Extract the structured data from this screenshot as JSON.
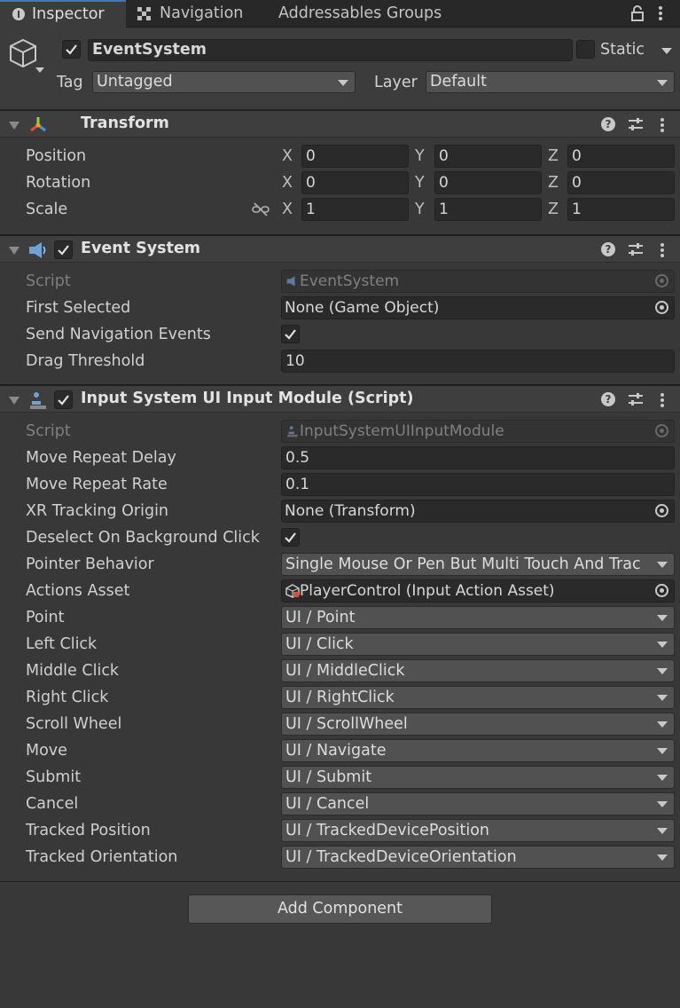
{
  "tabs": [
    {
      "label": "Inspector",
      "active": true
    },
    {
      "label": "Navigation",
      "active": false
    },
    {
      "label": "Addressables Groups",
      "active": false
    }
  ],
  "gameobject": {
    "name": "EventSystem",
    "active": true,
    "static_label": "Static",
    "static": false,
    "tag_label": "Tag",
    "tag_value": "Untagged",
    "layer_label": "Layer",
    "layer_value": "Default"
  },
  "transform": {
    "title": "Transform",
    "rows": [
      {
        "label": "Position",
        "x": "0",
        "y": "0",
        "z": "0"
      },
      {
        "label": "Rotation",
        "x": "0",
        "y": "0",
        "z": "0"
      },
      {
        "label": "Scale",
        "x": "1",
        "y": "1",
        "z": "1"
      }
    ],
    "axis": {
      "x": "X",
      "y": "Y",
      "z": "Z"
    }
  },
  "event_system": {
    "title": "Event System",
    "enabled": true,
    "script_label": "Script",
    "script_value": "EventSystem",
    "first_selected_label": "First Selected",
    "first_selected_value": "None (Game Object)",
    "send_nav_label": "Send Navigation Events",
    "send_nav_value": true,
    "drag_threshold_label": "Drag Threshold",
    "drag_threshold_value": "10"
  },
  "input_module": {
    "title": "Input System UI Input Module (Script)",
    "enabled": true,
    "script_label": "Script",
    "script_value": "InputSystemUIInputModule",
    "move_repeat_delay_label": "Move Repeat Delay",
    "move_repeat_delay_value": "0.5",
    "move_repeat_rate_label": "Move Repeat Rate",
    "move_repeat_rate_value": "0.1",
    "xr_origin_label": "XR Tracking Origin",
    "xr_origin_value": "None (Transform)",
    "deselect_label": "Deselect On Background Click",
    "deselect_value": true,
    "pointer_behavior_label": "Pointer Behavior",
    "pointer_behavior_value": "Single Mouse Or Pen But Multi Touch And Trac",
    "actions_asset_label": "Actions Asset",
    "actions_asset_value": "PlayerControl (Input Action Asset)",
    "actions": [
      {
        "label": "Point",
        "value": "UI / Point"
      },
      {
        "label": "Left Click",
        "value": "UI / Click"
      },
      {
        "label": "Middle Click",
        "value": "UI / MiddleClick"
      },
      {
        "label": "Right Click",
        "value": "UI / RightClick"
      },
      {
        "label": "Scroll Wheel",
        "value": "UI / ScrollWheel"
      },
      {
        "label": "Move",
        "value": "UI / Navigate"
      },
      {
        "label": "Submit",
        "value": "UI / Submit"
      },
      {
        "label": "Cancel",
        "value": "UI / Cancel"
      },
      {
        "label": "Tracked Position",
        "value": "UI / TrackedDevicePosition"
      },
      {
        "label": "Tracked Orientation",
        "value": "UI / TrackedDeviceOrientation"
      }
    ]
  },
  "add_component_label": "Add Component",
  "colors": {
    "background": "#383838",
    "tabbar": "#282828",
    "accent": "#3a79bb",
    "field": "#2a2a2a",
    "dropdown": "#515151"
  }
}
